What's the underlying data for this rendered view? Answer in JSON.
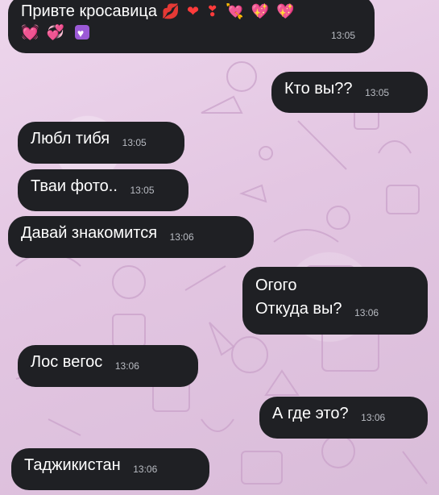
{
  "messages": [
    {
      "side": "in",
      "text": "Привте кросавица",
      "emojis": [
        "💋",
        "❤",
        "❣",
        "💘",
        "💖",
        "💖",
        "💓",
        "💞",
        "💟"
      ],
      "time": "13:05"
    },
    {
      "side": "out",
      "text": "Кто вы??",
      "time": "13:05"
    },
    {
      "side": "in",
      "text": "Любл тибя",
      "time": "13:05"
    },
    {
      "side": "in",
      "text": "Тваи фото..",
      "time": "13:05"
    },
    {
      "side": "in",
      "text": "Давай знакомится",
      "time": "13:06"
    },
    {
      "side": "out",
      "lines": [
        "Огого",
        "Откуда вы?"
      ],
      "time": "13:06"
    },
    {
      "side": "in",
      "text": "Лос вегос",
      "time": "13:06"
    },
    {
      "side": "out",
      "text": "А где это?",
      "time": "13:06"
    },
    {
      "side": "in",
      "text": "Таджикистан",
      "time": "13:06"
    }
  ],
  "colors": {
    "bubble_bg": "#1f2024",
    "bubble_text": "#ffffff",
    "timestamp": "#b9bcc3",
    "wallpaper": "#e8cfe6"
  }
}
